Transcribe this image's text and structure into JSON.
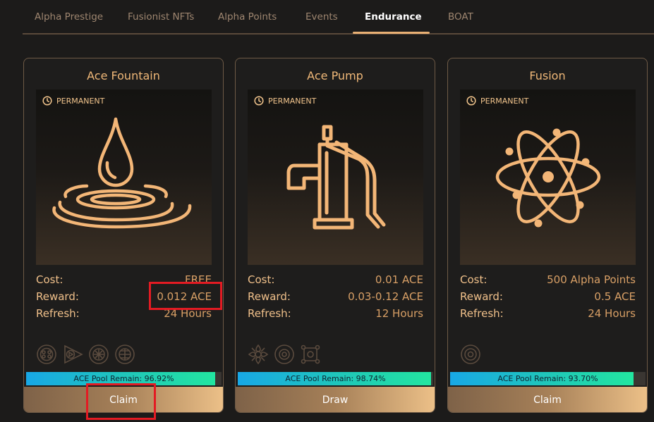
{
  "tabs": [
    {
      "label": "Alpha Prestige"
    },
    {
      "label": "Fusionist NFTs"
    },
    {
      "label": "Alpha Points"
    },
    {
      "label": "Events"
    },
    {
      "label": "Endurance",
      "active": true
    },
    {
      "label": "BOAT"
    }
  ],
  "labels": {
    "cost": "Cost:",
    "reward": "Reward:",
    "refresh": "Refresh:",
    "permanent": "PERMANENT"
  },
  "cards": [
    {
      "title": "Ace Fountain",
      "icon": "water-drop-icon",
      "cost": "FREE",
      "reward": "0.012 ACE",
      "refresh": "24 Hours",
      "pool_label": "ACE Pool Remain: 96.92%",
      "pool_percent": 96.92,
      "action": "Claim"
    },
    {
      "title": "Ace Pump",
      "icon": "water-pump-icon",
      "cost": "0.01 ACE",
      "reward": "0.03-0.12 ACE",
      "refresh": "12 Hours",
      "pool_label": "ACE Pool Remain: 98.74%",
      "pool_percent": 98.74,
      "action": "Draw"
    },
    {
      "title": "Fusion",
      "icon": "atom-icon",
      "cost": "500 Alpha Points",
      "reward": "0.5 ACE",
      "refresh": "24 Hours",
      "pool_label": "ACE Pool Remain: 93.70%",
      "pool_percent": 93.7,
      "action": "Claim"
    }
  ],
  "colors": {
    "accent": "#e8b074",
    "background": "#1c1b1a",
    "highlight": "#e31b23"
  }
}
